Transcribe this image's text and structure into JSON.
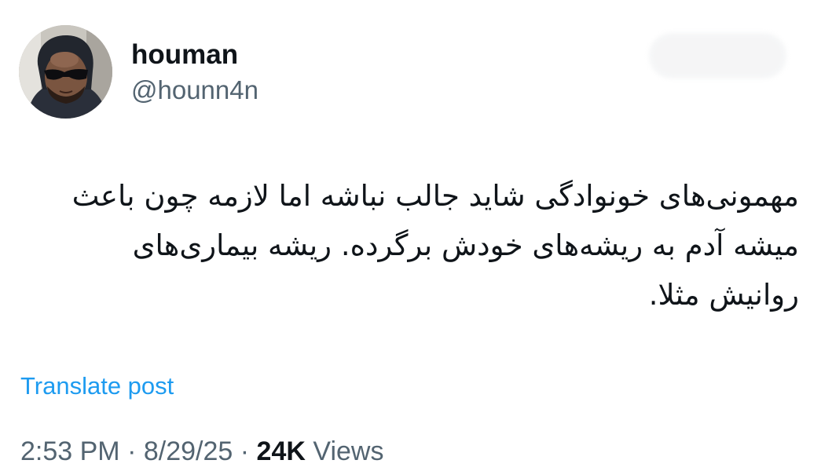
{
  "author": {
    "display_name": "houman",
    "handle": "@hounn4n",
    "avatar_icon": "profile-photo"
  },
  "post": {
    "text": "مهمونی‌های خونوادگی شاید جالب نباشه اما لازمه چون باعث میشه آدم به ریشه‌های خودش برگرده. ریشه بیماری‌های روانیش مثلا.",
    "translate_label": "Translate post"
  },
  "meta": {
    "time": "2:53 PM",
    "separator": "·",
    "date": "8/29/25",
    "views_count": "24K",
    "views_label": "Views"
  },
  "colors": {
    "link": "#1d9bf0",
    "secondary_text": "#536471",
    "primary_text": "#0f1419"
  }
}
